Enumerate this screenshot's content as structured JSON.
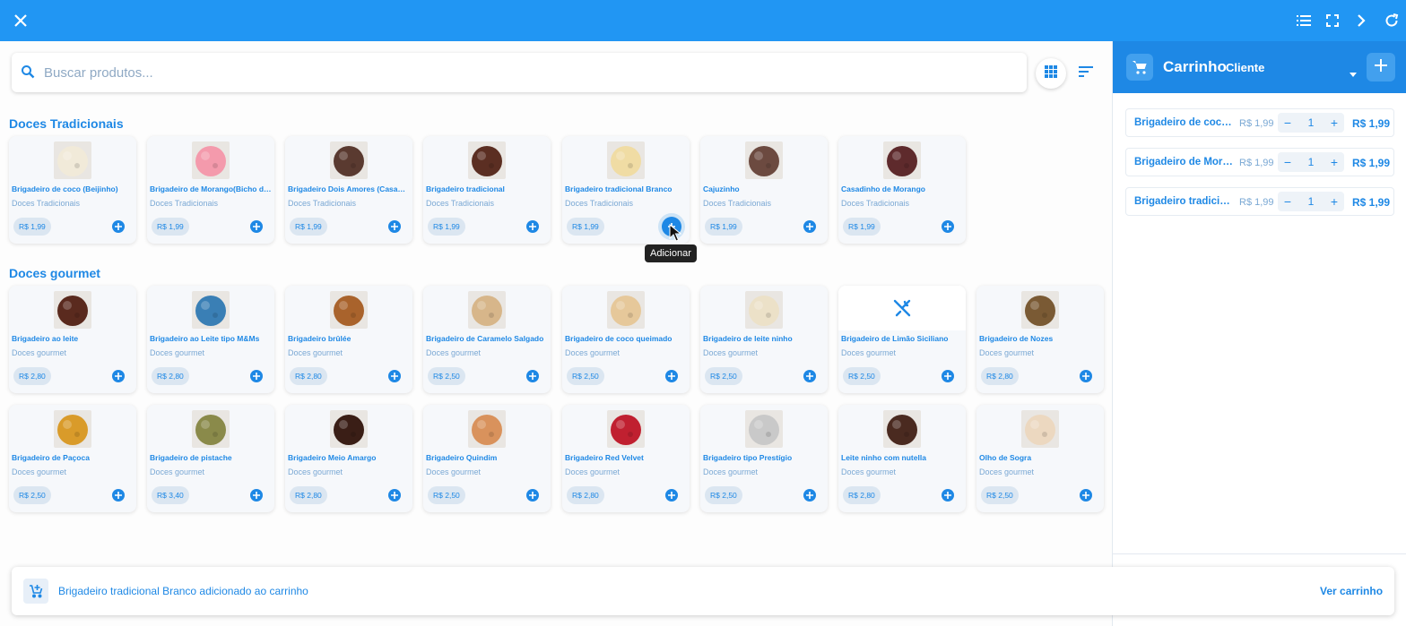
{
  "topbar": {
    "icons": [
      "close-icon",
      "list-icon",
      "fullscreen-icon",
      "chevron-right-icon",
      "refresh-icon"
    ]
  },
  "search": {
    "placeholder": "Buscar produtos...",
    "value": ""
  },
  "sections": [
    {
      "title": "Doces Tradicionais",
      "products": [
        {
          "name": "Brigadeiro de coco (Beijinho)",
          "category": "Doces Tradicionais",
          "price": "R$ 1,99",
          "image": "coconut-truffle",
          "color": "#f1ead9"
        },
        {
          "name": "Brigadeiro de Morango(Bicho de pé)",
          "category": "Doces Tradicionais",
          "price": "R$ 1,99",
          "image": "strawberry-truffle",
          "color": "#f49aac"
        },
        {
          "name": "Brigadeiro Dois Amores (Casadinho)",
          "category": "Doces Tradicionais",
          "price": "R$ 1,99",
          "image": "two-loves-truffle",
          "color": "#5a3a30"
        },
        {
          "name": "Brigadeiro tradicional",
          "category": "Doces Tradicionais",
          "price": "R$ 1,99",
          "image": "chocolate-truffle",
          "color": "#5b2e22"
        },
        {
          "name": "Brigadeiro tradicional Branco",
          "category": "Doces Tradicionais",
          "price": "R$ 1,99",
          "image": "white-truffle",
          "color": "#f0dca4"
        },
        {
          "name": "Cajuzinho",
          "category": "Doces Tradicionais",
          "price": "R$ 1,99",
          "image": "cashew-truffle",
          "color": "#6c4a40"
        },
        {
          "name": "Casadinho de Morango",
          "category": "Doces Tradicionais",
          "price": "R$ 1,99",
          "image": "strawberry-couple-truffle",
          "color": "#5e2a2c"
        }
      ]
    },
    {
      "title": "Doces gourmet",
      "products": [
        {
          "name": "Brigadeiro ao leite",
          "category": "Doces gourmet",
          "price": "R$ 2,80",
          "image": "milk-chocolate-truffle",
          "color": "#5a2a1e"
        },
        {
          "name": "Brigadeiro ao Leite tipo M&Ms",
          "category": "Doces gourmet",
          "price": "R$ 2,80",
          "image": "candy-truffle",
          "color": "#3a7fb5"
        },
        {
          "name": "Brigadeiro brûlée",
          "category": "Doces gourmet",
          "price": "R$ 2,80",
          "image": "brulee-truffle",
          "color": "#a9632c"
        },
        {
          "name": "Brigadeiro de Caramelo Salgado",
          "category": "Doces gourmet",
          "price": "R$ 2,50",
          "image": "caramel-truffle",
          "color": "#d7b68a"
        },
        {
          "name": "Brigadeiro de coco queimado",
          "category": "Doces gourmet",
          "price": "R$ 2,50",
          "image": "toasted-coconut-truffle",
          "color": "#e6c89a"
        },
        {
          "name": "Brigadeiro de leite ninho",
          "category": "Doces gourmet",
          "price": "R$ 2,50",
          "image": "milk-powder-truffle",
          "color": "#ece1c8"
        },
        {
          "name": "Brigadeiro de Limão Siciliano",
          "category": "Doces gourmet",
          "price": "R$ 2,50",
          "image": "utensils-icon",
          "color": "#ffffff"
        },
        {
          "name": "Brigadeiro de Nozes",
          "category": "Doces gourmet",
          "price": "R$ 2,80",
          "image": "walnut-truffle",
          "color": "#7a5a34"
        },
        {
          "name": "Brigadeiro de Paçoca",
          "category": "Doces gourmet",
          "price": "R$ 2,50",
          "image": "peanut-truffle",
          "color": "#d99b2a"
        },
        {
          "name": "Brigadeiro de pistache",
          "category": "Doces gourmet",
          "price": "R$ 3,40",
          "image": "pistachio-truffle",
          "color": "#8a8a4a"
        },
        {
          "name": "Brigadeiro Meio Amargo",
          "category": "Doces gourmet",
          "price": "R$ 2,80",
          "image": "dark-chocolate-truffle",
          "color": "#3a1e16"
        },
        {
          "name": "Brigadeiro Quindim",
          "category": "Doces gourmet",
          "price": "R$ 2,50",
          "image": "quindim-truffle",
          "color": "#d9925c"
        },
        {
          "name": "Brigadeiro Red Velvet",
          "category": "Doces gourmet",
          "price": "R$ 2,80",
          "image": "red-velvet-truffle",
          "color": "#c02030"
        },
        {
          "name": "Brigadeiro tipo Prestígio",
          "category": "Doces gourmet",
          "price": "R$ 2,50",
          "image": "prestigio-truffle",
          "color": "#c9c9c9"
        },
        {
          "name": "Leite ninho com nutella",
          "category": "Doces gourmet",
          "price": "R$ 2,80",
          "image": "nutella-truffle",
          "color": "#4a2a20"
        },
        {
          "name": "Olho de Sogra",
          "category": "Doces gourmet",
          "price": "R$ 2,50",
          "image": "olho-de-sogra-sweet",
          "color": "#ecd8c0"
        }
      ]
    }
  ],
  "tooltip": "Adicionar",
  "cart": {
    "title": "Carrinho",
    "client": "Cliente",
    "items": [
      {
        "name": "Brigadeiro de coco (Beijinho)",
        "unit_price": "R$ 1,99",
        "qty": "1",
        "total": "R$ 1,99"
      },
      {
        "name": "Brigadeiro de Morango(Bicho de pé)",
        "unit_price": "R$ 1,99",
        "qty": "1",
        "total": "R$ 1,99"
      },
      {
        "name": "Brigadeiro tradicional",
        "unit_price": "R$ 1,99",
        "qty": "1",
        "total": "R$ 1,99"
      }
    ]
  },
  "snackbar": {
    "message": "Brigadeiro tradicional Branco adicionado ao carrinho",
    "action": "Ver carrinho"
  },
  "colors": {
    "primary": "#1e88e5",
    "topbar": "#2196f3",
    "muted": "#7aa8d4"
  }
}
